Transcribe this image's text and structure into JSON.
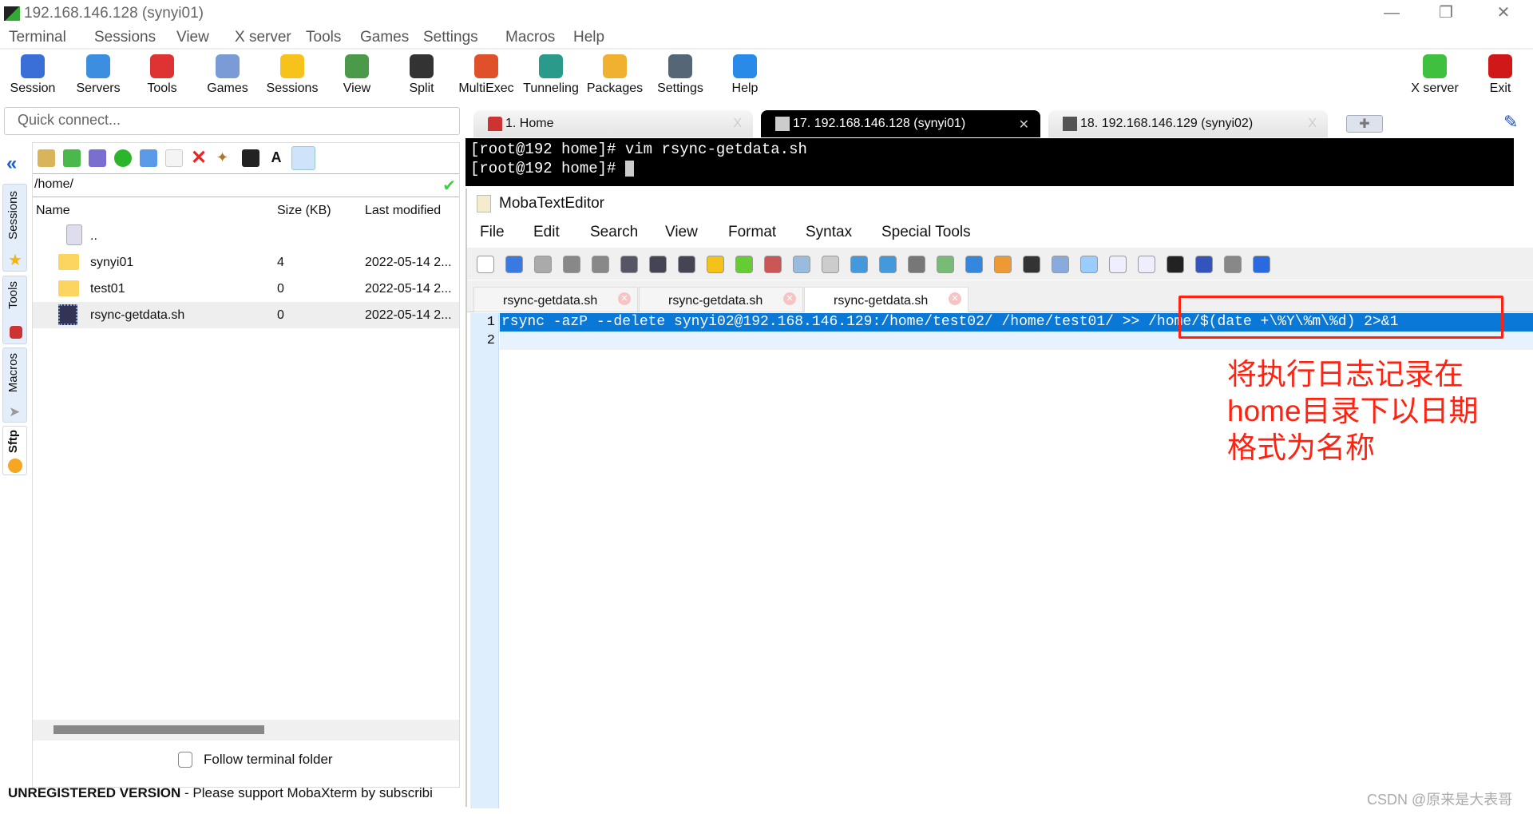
{
  "window": {
    "title": "192.168.146.128 (synyi01)",
    "minimize": "—",
    "restore": "❐",
    "close": "✕"
  },
  "menu": [
    "Terminal",
    "Sessions",
    "View",
    "X server",
    "Tools",
    "Games",
    "Settings",
    "Macros",
    "Help"
  ],
  "toolbar": [
    {
      "label": "Session",
      "color": "#3a6fd8"
    },
    {
      "label": "Servers",
      "color": "#3b8ee0"
    },
    {
      "label": "Tools",
      "color": "#d33"
    },
    {
      "label": "Games",
      "color": "#7a9bd6"
    },
    {
      "label": "Sessions",
      "color": "#f7c21a"
    },
    {
      "label": "View",
      "color": "#4a9a4a"
    },
    {
      "label": "Split",
      "color": "#333"
    },
    {
      "label": "MultiExec",
      "color": "#e0502a"
    },
    {
      "label": "Tunneling",
      "color": "#2a9a8a"
    },
    {
      "label": "Packages",
      "color": "#f0b030"
    },
    {
      "label": "Settings",
      "color": "#567"
    },
    {
      "label": "Help",
      "color": "#2a8ae8"
    }
  ],
  "toolbar_right": [
    {
      "label": "X server",
      "color": "#3fc03f"
    },
    {
      "label": "Exit",
      "color": "#d01818"
    }
  ],
  "quick_connect": {
    "placeholder": "Quick connect..."
  },
  "side_tabs": [
    "Sessions",
    "Tools",
    "Macros",
    "Sftp"
  ],
  "sftp": {
    "path": "/home/",
    "columns": [
      "Name",
      "Size (KB)",
      "Last modified"
    ],
    "rows": [
      {
        "name": "..",
        "size": "",
        "modified": "",
        "type": "parent"
      },
      {
        "name": "synyi01",
        "size": "4",
        "modified": "2022-05-14 2...",
        "type": "folder"
      },
      {
        "name": "test01",
        "size": "0",
        "modified": "2022-05-14 2...",
        "type": "folder"
      },
      {
        "name": "rsync-getdata.sh",
        "size": "0",
        "modified": "2022-05-14 2...",
        "type": "file"
      }
    ],
    "follow_label": "Follow terminal folder"
  },
  "status": {
    "bold": "UNREGISTERED VERSION",
    "text": " -  Please support MobaXterm by subscribi"
  },
  "tabs": [
    {
      "label": "1. Home",
      "close": "X"
    },
    {
      "label": "17. 192.168.146.128 (synyi01)",
      "close": "✕"
    },
    {
      "label": "18. 192.168.146.129  (synyi02)",
      "close": "X"
    }
  ],
  "terminal": {
    "lines": [
      "[root@192 home]# vim rsync-getdata.sh",
      "[root@192 home]# "
    ]
  },
  "editor": {
    "title": "MobaTextEditor",
    "menu": [
      "File",
      "Edit",
      "Search",
      "View",
      "Format",
      "Syntax",
      "Special Tools"
    ],
    "tabs": [
      "rsync-getdata.sh",
      "rsync-getdata.sh",
      "rsync-getdata.sh"
    ],
    "lines": [
      "rsync -azP --delete synyi02@192.168.146.129:/home/test02/ /home/test01/ >> /home/$(date +\\%Y\\%m\\%d) 2>&1",
      ""
    ],
    "line_numbers": [
      "1",
      "2"
    ]
  },
  "annotation": {
    "lines": [
      "将执行日志记录在",
      "home目录下以日期",
      "格式为名称"
    ],
    "color": "#ff2211"
  },
  "watermark": "CSDN @原来是大表哥"
}
